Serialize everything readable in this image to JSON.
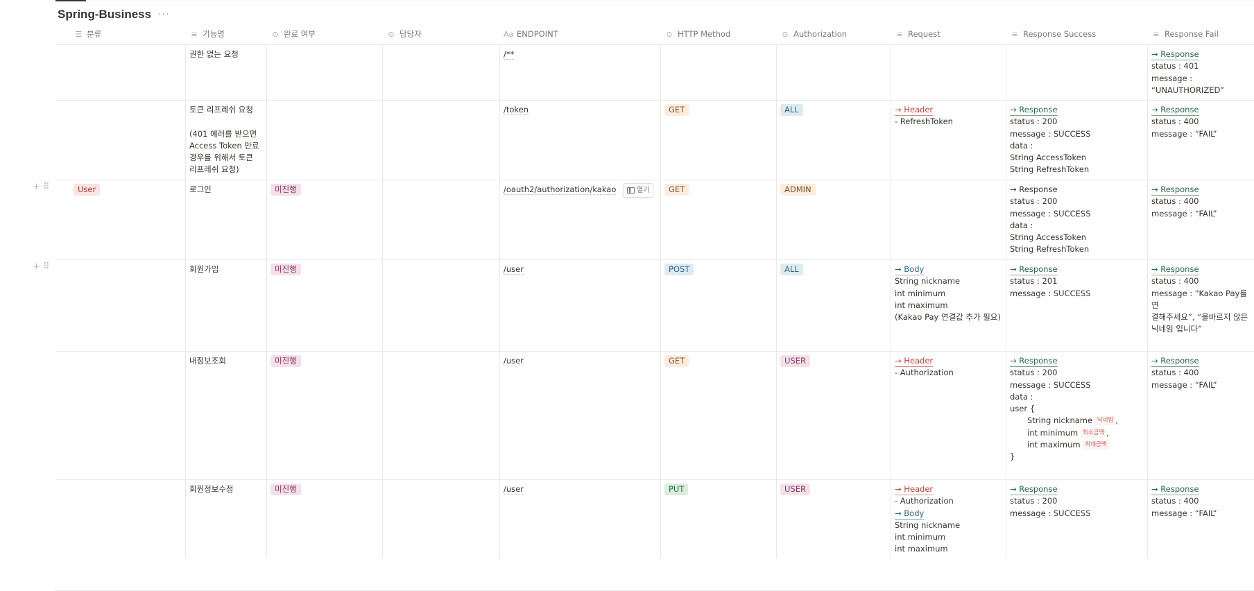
{
  "page": {
    "title": "Spring-Business",
    "more": "···"
  },
  "columns": [
    {
      "label": "분류",
      "icon": "☰"
    },
    {
      "label": "기능명",
      "icon": "≡"
    },
    {
      "label": "완료 여부",
      "icon": "⊙"
    },
    {
      "label": "담당자",
      "icon": "⊙"
    },
    {
      "label": "ENDPOINT",
      "icon": "Aa"
    },
    {
      "label": "HTTP Method",
      "icon": "⊙"
    },
    {
      "label": "Authorization",
      "icon": "⊙"
    },
    {
      "label": "Request",
      "icon": "≡"
    },
    {
      "label": "Response Success",
      "icon": "≡"
    },
    {
      "label": "Response Fail",
      "icon": "≡"
    }
  ],
  "open_button": "열기",
  "rows": [
    {
      "category": "",
      "name": [
        "권한 없는 요청"
      ],
      "status": "",
      "assignee": "",
      "endpoint": "/**",
      "method": "",
      "auth": "",
      "request": [],
      "success": [],
      "fail": [
        {
          "t": "→ Response",
          "s": "link-green"
        },
        {
          "t": "status : 401"
        },
        {
          "t": "message :"
        },
        {
          "t": "“UNAUTHORIZED”"
        }
      ]
    },
    {
      "category": "",
      "name": [
        "토큰 리프레쉬 요청",
        "",
        "(401 에러를 받으면",
        "Access Token 만료",
        "경우를 위해서 토큰",
        "리프레쉬 요청)"
      ],
      "status": "",
      "assignee": "",
      "endpoint": "/token",
      "method": "GET",
      "auth": "ALL",
      "request": [
        {
          "t": "→ Header",
          "s": "link-red"
        },
        {
          "t": "- RefreshToken"
        }
      ],
      "success": [
        {
          "t": "→ Response",
          "s": "link-green"
        },
        {
          "t": "status : 200"
        },
        {
          "t": "message : SUCCESS"
        },
        {
          "t": "data :"
        },
        {
          "t": "String AccessToken"
        },
        {
          "t": "String RefreshToken"
        }
      ],
      "fail": [
        {
          "t": "→ Response",
          "s": "link-green"
        },
        {
          "t": "status : 400"
        },
        {
          "t": "message : “FAIL”"
        }
      ]
    },
    {
      "category": "User",
      "name": [
        "로그인"
      ],
      "status": "미진행",
      "assignee": "",
      "endpoint": "/oauth2/authorization/kakao",
      "method": "GET",
      "auth": "ADMIN",
      "request": [],
      "success": [
        {
          "t": "→ Response",
          "s": "link-plain"
        },
        {
          "t": "status : 200"
        },
        {
          "t": "message : SUCCESS"
        },
        {
          "t": "data :"
        },
        {
          "t": "String AccessToken"
        },
        {
          "t": "String RefreshToken"
        }
      ],
      "fail": [
        {
          "t": "→ Response",
          "s": "link-green"
        },
        {
          "t": "status : 400"
        },
        {
          "t": "message : “FAIL”"
        }
      ]
    },
    {
      "category": "",
      "name": [
        "회원가입"
      ],
      "status": "미진행",
      "assignee": "",
      "endpoint": "/user",
      "method": "POST",
      "auth": "ALL",
      "request": [
        {
          "t": "→ Body",
          "s": "link-blue"
        },
        {
          "t": "String  nickname"
        },
        {
          "t": "int minimum"
        },
        {
          "t": "int maximum"
        },
        {
          "t": "(Kakao Pay 연결값 추가 필요)"
        }
      ],
      "success": [
        {
          "t": "→ Response",
          "s": "link-green"
        },
        {
          "t": "status : 201"
        },
        {
          "t": "message : SUCCESS"
        }
      ],
      "fail": [
        {
          "t": "→ Response",
          "s": "link-green"
        },
        {
          "t": "status : 400"
        },
        {
          "t": "message : “Kakao Pay를 연"
        },
        {
          "t": "결해주세요”, “올바르지 않은"
        },
        {
          "t": "닉네임 입니다”"
        }
      ]
    },
    {
      "category": "",
      "name": [
        "내정보조회"
      ],
      "status": "미진행",
      "assignee": "",
      "endpoint": "/user",
      "method": "GET",
      "auth": "USER",
      "request": [
        {
          "t": "→ Header",
          "s": "link-red"
        },
        {
          "t": "- Authorization"
        }
      ],
      "success": [
        {
          "t": "→ Response",
          "s": "link-green"
        },
        {
          "t": "status : 200"
        },
        {
          "t": "message : SUCCESS"
        },
        {
          "t": "data :"
        },
        {
          "t": "user {"
        },
        {
          "t": "String nickname ",
          "code": "닉네임",
          "after": ",",
          "indent": true
        },
        {
          "t": "int minimum ",
          "code": "최소금액",
          "after": ",",
          "indent": true
        },
        {
          "t": "int maximum ",
          "code": "최대금액",
          "indent": true
        },
        {
          "t": "}"
        }
      ],
      "fail": [
        {
          "t": "→ Response",
          "s": "link-green"
        },
        {
          "t": "status : 400"
        },
        {
          "t": "message : “FAIL”"
        }
      ]
    },
    {
      "category": "",
      "name": [
        "회원정보수정"
      ],
      "status": "미진행",
      "assignee": "",
      "endpoint": "/user",
      "method": "PUT",
      "auth": "USER",
      "request": [
        {
          "t": "→ Header",
          "s": "link-red"
        },
        {
          "t": "- Authorization"
        },
        {
          "t": "→ Body",
          "s": "link-blue"
        },
        {
          "t": "String  nickname"
        },
        {
          "t": "int minimum"
        },
        {
          "t": "int maximum"
        }
      ],
      "success": [
        {
          "t": "→ Response",
          "s": "link-green"
        },
        {
          "t": "status : 200"
        },
        {
          "t": "message : SUCCESS"
        }
      ],
      "fail": [
        {
          "t": "→ Response",
          "s": "link-green"
        },
        {
          "t": "status : 400"
        },
        {
          "t": "message : “FAIL”"
        }
      ]
    }
  ],
  "colors": {
    "category_user": "#fbe4e4",
    "status_pending": "#f5e0e9",
    "method_get": "#fbecdd",
    "method_post": "#ddebf1",
    "method_put": "#dbeddb",
    "auth_all": "#ddebf1",
    "auth_admin": "#fbecdd",
    "auth_user": "#f5e0e9"
  }
}
